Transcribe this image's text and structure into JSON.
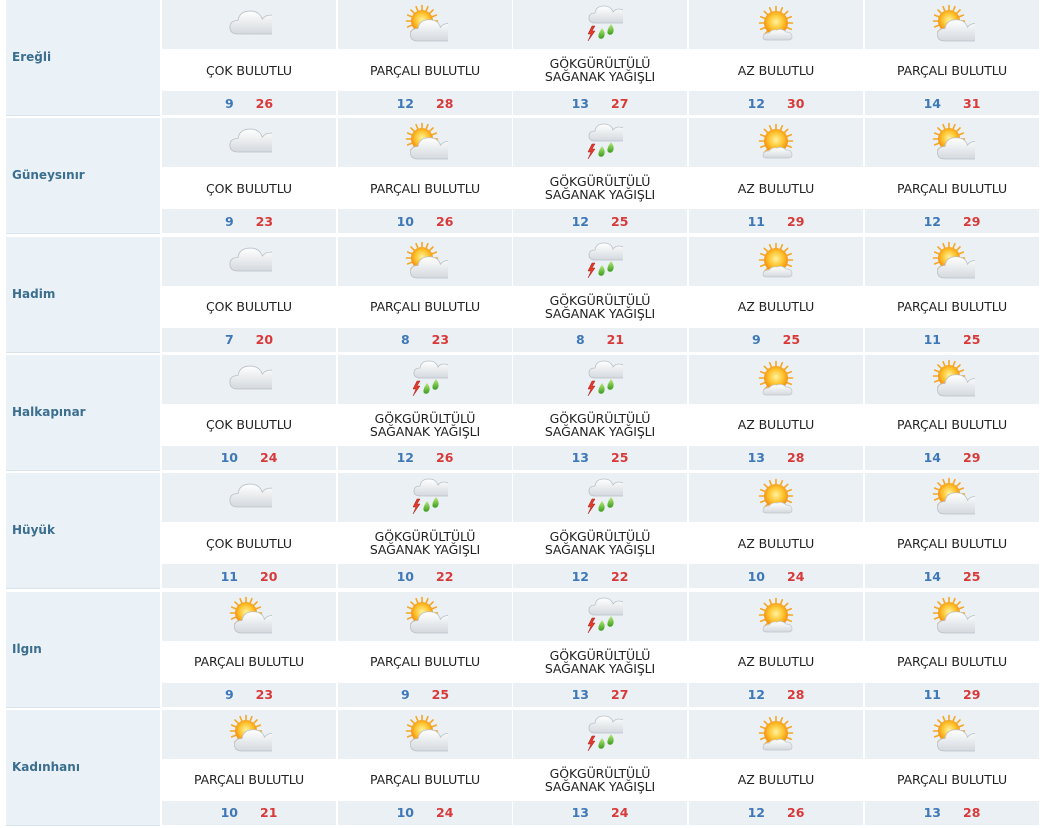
{
  "cities": [
    {
      "name": "Ereğli",
      "days": [
        {
          "icon": "cloudy-icon",
          "condition": "ÇOK BULUTLU",
          "min": "9",
          "max": "26"
        },
        {
          "icon": "partly-cloudy-icon",
          "condition": "PARÇALI BULUTLU",
          "min": "12",
          "max": "28"
        },
        {
          "icon": "thunderstorm-icon",
          "condition": "GÖKGÜRÜLTÜLÜ\nSAĞANAK YAĞIŞLI",
          "min": "13",
          "max": "27"
        },
        {
          "icon": "mostly-sunny-icon",
          "condition": "AZ BULUTLU",
          "min": "12",
          "max": "30"
        },
        {
          "icon": "partly-cloudy-icon",
          "condition": "PARÇALI BULUTLU",
          "min": "14",
          "max": "31"
        }
      ]
    },
    {
      "name": "Güneysınır",
      "days": [
        {
          "icon": "cloudy-icon",
          "condition": "ÇOK BULUTLU",
          "min": "9",
          "max": "23"
        },
        {
          "icon": "partly-cloudy-icon",
          "condition": "PARÇALI BULUTLU",
          "min": "10",
          "max": "26"
        },
        {
          "icon": "thunderstorm-icon",
          "condition": "GÖKGÜRÜLTÜLÜ\nSAĞANAK YAĞIŞLI",
          "min": "12",
          "max": "25"
        },
        {
          "icon": "mostly-sunny-icon",
          "condition": "AZ BULUTLU",
          "min": "11",
          "max": "29"
        },
        {
          "icon": "partly-cloudy-icon",
          "condition": "PARÇALI BULUTLU",
          "min": "12",
          "max": "29"
        }
      ]
    },
    {
      "name": "Hadim",
      "days": [
        {
          "icon": "cloudy-icon",
          "condition": "ÇOK BULUTLU",
          "min": "7",
          "max": "20"
        },
        {
          "icon": "partly-cloudy-icon",
          "condition": "PARÇALI BULUTLU",
          "min": "8",
          "max": "23"
        },
        {
          "icon": "thunderstorm-icon",
          "condition": "GÖKGÜRÜLTÜLÜ\nSAĞANAK YAĞIŞLI",
          "min": "8",
          "max": "21"
        },
        {
          "icon": "mostly-sunny-icon",
          "condition": "AZ BULUTLU",
          "min": "9",
          "max": "25"
        },
        {
          "icon": "partly-cloudy-icon",
          "condition": "PARÇALI BULUTLU",
          "min": "11",
          "max": "25"
        }
      ]
    },
    {
      "name": "Halkapınar",
      "days": [
        {
          "icon": "cloudy-icon",
          "condition": "ÇOK BULUTLU",
          "min": "10",
          "max": "24"
        },
        {
          "icon": "thunderstorm-icon",
          "condition": "GÖKGÜRÜLTÜLÜ\nSAĞANAK YAĞIŞLI",
          "min": "12",
          "max": "26"
        },
        {
          "icon": "thunderstorm-icon",
          "condition": "GÖKGÜRÜLTÜLÜ\nSAĞANAK YAĞIŞLI",
          "min": "13",
          "max": "25"
        },
        {
          "icon": "mostly-sunny-icon",
          "condition": "AZ BULUTLU",
          "min": "13",
          "max": "28"
        },
        {
          "icon": "partly-cloudy-icon",
          "condition": "PARÇALI BULUTLU",
          "min": "14",
          "max": "29"
        }
      ]
    },
    {
      "name": "Hüyük",
      "days": [
        {
          "icon": "cloudy-icon",
          "condition": "ÇOK BULUTLU",
          "min": "11",
          "max": "20"
        },
        {
          "icon": "thunderstorm-icon",
          "condition": "GÖKGÜRÜLTÜLÜ\nSAĞANAK YAĞIŞLI",
          "min": "10",
          "max": "22"
        },
        {
          "icon": "thunderstorm-icon",
          "condition": "GÖKGÜRÜLTÜLÜ\nSAĞANAK YAĞIŞLI",
          "min": "12",
          "max": "22"
        },
        {
          "icon": "mostly-sunny-icon",
          "condition": "AZ BULUTLU",
          "min": "10",
          "max": "24"
        },
        {
          "icon": "partly-cloudy-icon",
          "condition": "PARÇALI BULUTLU",
          "min": "14",
          "max": "25"
        }
      ]
    },
    {
      "name": "Ilgın",
      "days": [
        {
          "icon": "partly-cloudy-icon",
          "condition": "PARÇALI BULUTLU",
          "min": "9",
          "max": "23"
        },
        {
          "icon": "partly-cloudy-icon",
          "condition": "PARÇALI BULUTLU",
          "min": "9",
          "max": "25"
        },
        {
          "icon": "thunderstorm-icon",
          "condition": "GÖKGÜRÜLTÜLÜ\nSAĞANAK YAĞIŞLI",
          "min": "13",
          "max": "27"
        },
        {
          "icon": "mostly-sunny-icon",
          "condition": "AZ BULUTLU",
          "min": "12",
          "max": "28"
        },
        {
          "icon": "partly-cloudy-icon",
          "condition": "PARÇALI BULUTLU",
          "min": "11",
          "max": "29"
        }
      ]
    },
    {
      "name": "Kadınhanı",
      "days": [
        {
          "icon": "partly-cloudy-icon",
          "condition": "PARÇALI BULUTLU",
          "min": "10",
          "max": "21"
        },
        {
          "icon": "partly-cloudy-icon",
          "condition": "PARÇALI BULUTLU",
          "min": "10",
          "max": "24"
        },
        {
          "icon": "thunderstorm-icon",
          "condition": "GÖKGÜRÜLTÜLÜ\nSAĞANAK YAĞIŞLI",
          "min": "13",
          "max": "24"
        },
        {
          "icon": "mostly-sunny-icon",
          "condition": "AZ BULUTLU",
          "min": "12",
          "max": "26"
        },
        {
          "icon": "partly-cloudy-icon",
          "condition": "PARÇALI BULUTLU",
          "min": "13",
          "max": "28"
        }
      ]
    }
  ],
  "colors": {
    "min_temp": "#3e78b8",
    "max_temp": "#d83a3a",
    "city_name": "#3b6e8f"
  }
}
